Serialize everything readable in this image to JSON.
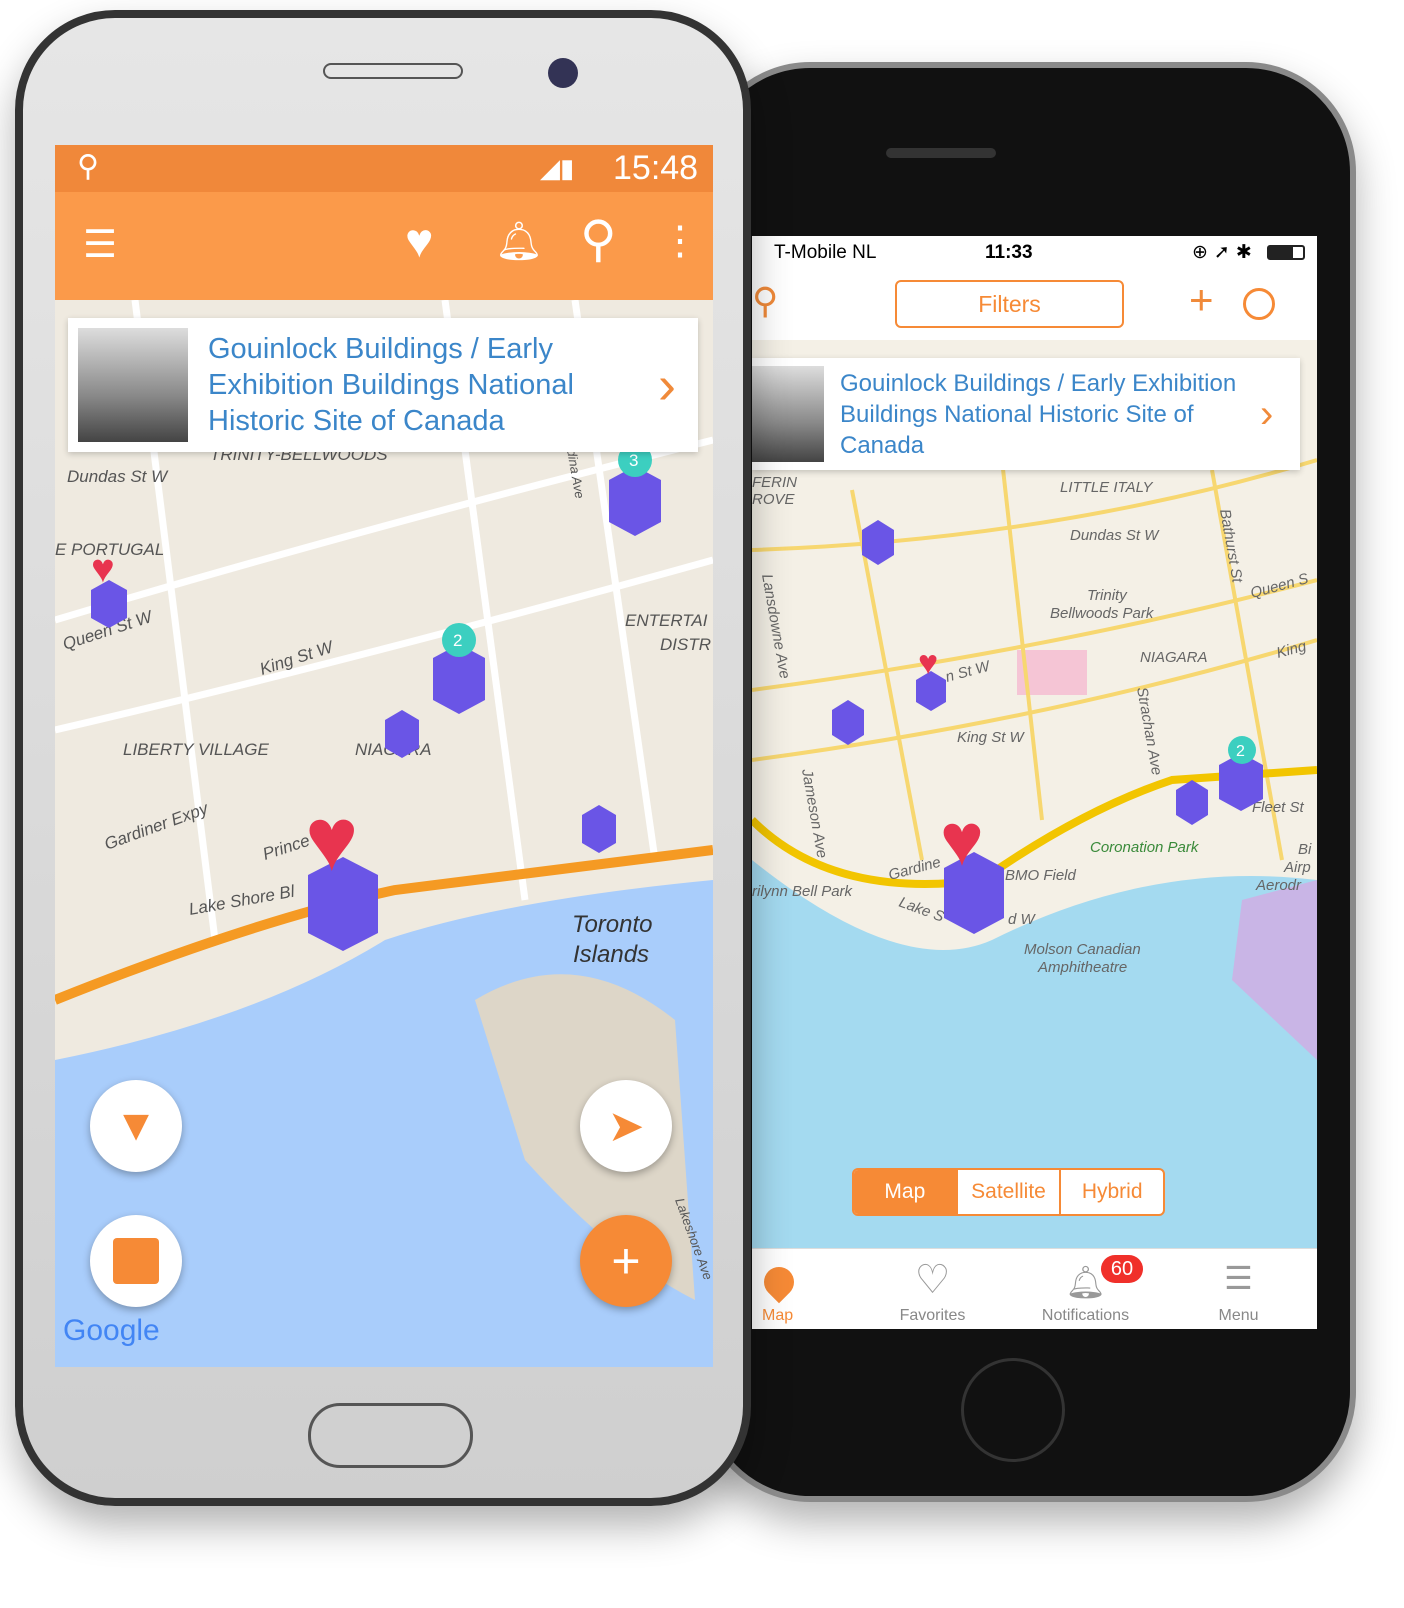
{
  "android": {
    "status": {
      "time": "15:48",
      "icons": [
        "location-pin-icon",
        "signal-icon",
        "battery-icon"
      ]
    },
    "toolbar": {
      "icons": [
        "menu-icon",
        "heart-icon",
        "bell-icon",
        "search-icon",
        "more-vert-icon"
      ]
    },
    "card": {
      "title": "Gouinlock Buildings / Early Exhibition Buildings National Historic Site of Canada"
    },
    "map": {
      "labels": [
        "Dundas St W",
        "TRINITY-BELLWOODS",
        "E PORTUGAL",
        "Queen St W",
        "King St W",
        "ENTERTAI",
        "DISTR",
        "LIBERTY VILLAGE",
        "NIAGARA",
        "Gardiner Expy",
        "Prince",
        "Lake Shore Bl",
        "Toronto",
        "Islands",
        "dina Ave",
        "Lakeshore Ave"
      ],
      "clusters": [
        "3",
        "2"
      ],
      "logo": "Google"
    },
    "fabs": [
      "filter-icon",
      "image-icon",
      "navigation-icon",
      "plus-icon"
    ]
  },
  "iphone": {
    "status": {
      "carrier": "T-Mobile NL",
      "time": "11:33"
    },
    "nav": {
      "filters_label": "Filters"
    },
    "card": {
      "title": "Gouinlock Buildings / Early Exhibition Buildings National Historic Site of Canada"
    },
    "map": {
      "labels": [
        "FERIN",
        "ROVE",
        "LITTLE ITALY",
        "Dundas St W",
        "Bathurst St",
        "Queen S",
        "Trinity",
        "Bellwoods Park",
        "NIAGARA",
        "King",
        "Lansdowne Ave",
        "n St W",
        "King St W",
        "Strachan Ave",
        "Jameson Ave",
        "Fleet St",
        "Coronation Park",
        "Bi",
        "Airp",
        "Aerodr",
        "Gardine",
        "BMO Field",
        "rilynn Bell Park",
        "Lake S",
        "d W",
        "Molson Canadian",
        "Amphitheatre"
      ],
      "clusters": [
        "2"
      ]
    },
    "map_types": {
      "options": [
        "Map",
        "Satellite",
        "Hybrid"
      ],
      "selected": "Map"
    },
    "tabs": [
      {
        "label": "Map",
        "active": true
      },
      {
        "label": "Favorites"
      },
      {
        "label": "Notifications",
        "badge": "60"
      },
      {
        "label": "Menu"
      }
    ]
  },
  "colors": {
    "accent": "#f68a36",
    "title": "#3b86c9",
    "marker": "#6a55e6",
    "heart": "#e8344f",
    "cluster": "#3ccfc0",
    "badge": "#f0302a"
  }
}
